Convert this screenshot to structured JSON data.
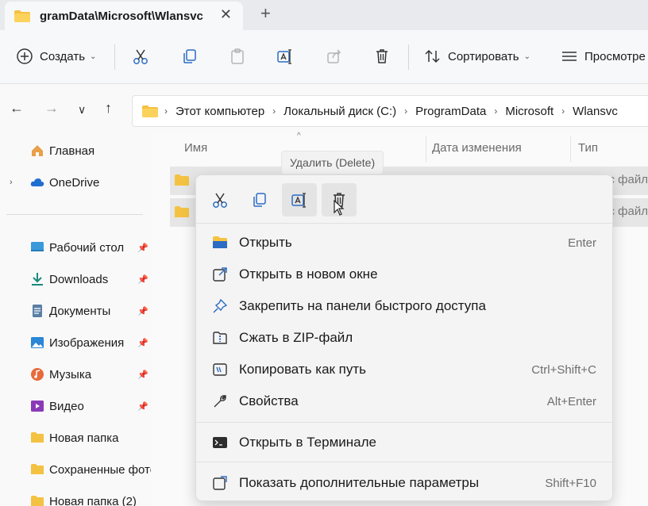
{
  "tab": {
    "title": "gramData\\Microsoft\\Wlansvc",
    "close": "✕",
    "new_tab": "+"
  },
  "toolbar": {
    "create_label": "Создать",
    "sort_label": "Сортировать",
    "view_label": "Просмотре"
  },
  "nav": {
    "back": "←",
    "forward": "→",
    "recent": "∨",
    "up": "↑"
  },
  "address": {
    "crumbs": [
      "Этот компьютер",
      "Локальный диск (C:)",
      "ProgramData",
      "Microsoft",
      "Wlansvc"
    ],
    "sep": "›"
  },
  "sidebar": {
    "home": "Главная",
    "onedrive": "OneDrive",
    "items": [
      {
        "label": "Рабочий стол",
        "icon": "desktop-icon"
      },
      {
        "label": "Downloads",
        "icon": "download-icon"
      },
      {
        "label": "Документы",
        "icon": "documents-icon"
      },
      {
        "label": "Изображения",
        "icon": "pictures-icon"
      },
      {
        "label": "Музыка",
        "icon": "music-icon"
      },
      {
        "label": "Видео",
        "icon": "video-icon"
      },
      {
        "label": "Новая папка",
        "icon": "folder-icon"
      },
      {
        "label": "Сохраненные фото",
        "icon": "folder-icon"
      },
      {
        "label": "Новая папка (2)",
        "icon": "folder-icon"
      }
    ],
    "pin": "📌"
  },
  "columns": {
    "name": "Имя",
    "date": "Дата изменения",
    "type": "Тип",
    "sort_arrow": "^"
  },
  "rows": [
    {
      "type": "с файл"
    },
    {
      "type": "с файл"
    }
  ],
  "tooltip": "Удалить (Delete)",
  "context_menu": {
    "items": [
      {
        "label": "Открыть",
        "shortcut": "Enter"
      },
      {
        "label": "Открыть в новом окне",
        "shortcut": ""
      },
      {
        "label": "Закрепить на панели быстрого доступа",
        "shortcut": ""
      },
      {
        "label": "Сжать в ZIP-файл",
        "shortcut": ""
      },
      {
        "label": "Копировать как путь",
        "shortcut": "Ctrl+Shift+C"
      },
      {
        "label": "Свойства",
        "shortcut": "Alt+Enter"
      },
      {
        "label": "Открыть в Терминале",
        "shortcut": ""
      },
      {
        "label": "Показать дополнительные параметры",
        "shortcut": "Shift+F10"
      }
    ]
  },
  "colors": {
    "folder": "#f4c242",
    "accent": "#1f6fd1",
    "menu_bg": "#f4f4f4"
  }
}
